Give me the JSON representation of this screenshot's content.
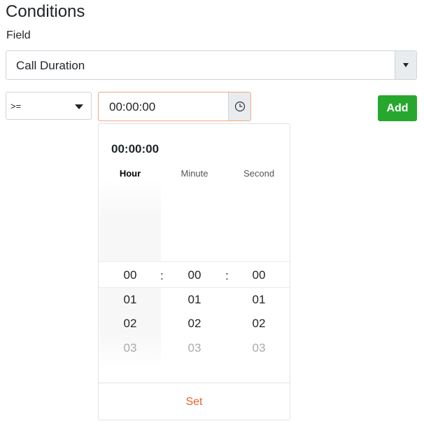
{
  "page": {
    "title": "Conditions"
  },
  "field": {
    "label": "Field",
    "selected": "Call Duration"
  },
  "operator": {
    "selected": ">="
  },
  "time_input": {
    "value": "00:00:00"
  },
  "actions": {
    "add_label": "Add"
  },
  "time_picker": {
    "current": "00:00:00",
    "columns": [
      {
        "label": "Hour",
        "active": true
      },
      {
        "label": "Minute",
        "active": false
      },
      {
        "label": "Second",
        "active": false
      }
    ],
    "selected": {
      "hour": "00",
      "minute": "00",
      "second": "00"
    },
    "options": [
      {
        "hour": "01",
        "minute": "01",
        "second": "01"
      },
      {
        "hour": "02",
        "minute": "02",
        "second": "02"
      },
      {
        "hour": "03",
        "minute": "03",
        "second": "03"
      }
    ],
    "separator": ":",
    "set_label": "Set"
  },
  "colors": {
    "accent": "#e8632b",
    "add_button": "#28a72e",
    "input_focus_border": "#f0a97e"
  },
  "icons": {
    "field_dropdown": "caret-down-icon",
    "operator_dropdown": "caret-down-icon",
    "time": "clock-icon"
  }
}
